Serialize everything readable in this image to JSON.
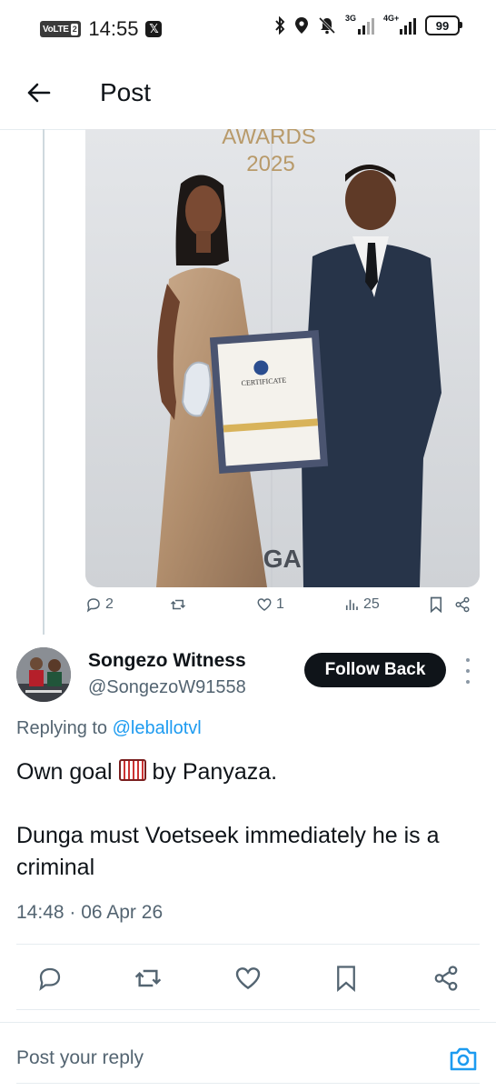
{
  "status_bar": {
    "volte": "VoLTE",
    "sim": "2",
    "time": "14:55",
    "app_icon": "x-logo-icon",
    "net1": "3G",
    "net2": "4G+",
    "battery": "99"
  },
  "header": {
    "title": "Post"
  },
  "photo": {
    "banner_line1": "AWARDS",
    "banner_line2": "2025",
    "certificate_label": "CERTIFICATE",
    "backdrop_text": ".GA"
  },
  "post_actions": {
    "replies": "2",
    "reposts": "",
    "likes": "1",
    "views": "25"
  },
  "reply": {
    "display_name": "Songezo Witness",
    "handle": "@SongezoW91558",
    "follow_label": "Follow Back",
    "replying_prefix": "Replying to ",
    "replying_to": "@leballotvl",
    "text_line1_a": "Own goal ",
    "text_line1_b": " by Panyaza.",
    "text_line2": "Dunga must Voetseek immediately he is a criminal",
    "timestamp": "14:48 · 06 Apr 26"
  },
  "composer": {
    "placeholder": "Post your reply"
  },
  "colors": {
    "accent": "#1d9bf0",
    "text": "#0f1419",
    "muted": "#536471",
    "button": "#0f1419"
  }
}
